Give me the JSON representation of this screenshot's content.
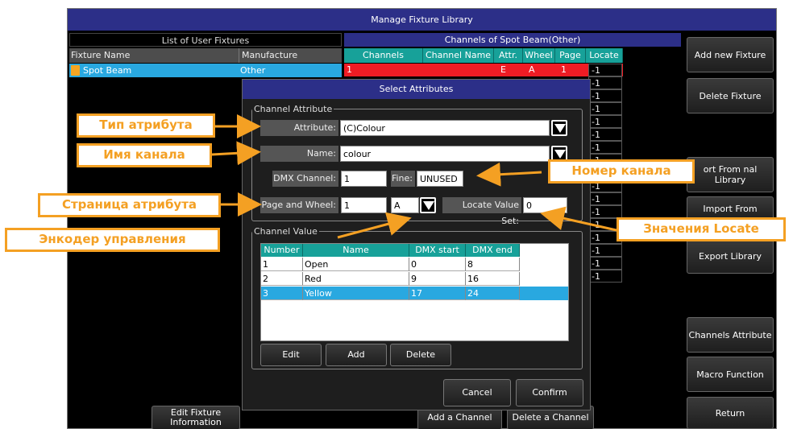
{
  "window": {
    "title": "Manage Fixture Library"
  },
  "left_panel": {
    "title": "List of User Fixtures",
    "columns": [
      "Fixture Name",
      "Manufacture"
    ],
    "rows": [
      {
        "name": "Spot Beam",
        "manufacturer": "Other"
      }
    ]
  },
  "channel_panel": {
    "title": "Channels of Spot Beam(Other)",
    "columns": [
      "Channels",
      "Channel Name",
      "Attr.",
      "Wheel",
      "Page",
      "Locate"
    ],
    "first_row": {
      "channel": "1",
      "attr": "E",
      "wheel": "A",
      "page": "1",
      "locate": "-1"
    },
    "locate_values": [
      "-1",
      "-1",
      "-1",
      "-1",
      "-1",
      "-1",
      "-1",
      "-1",
      "-1",
      "-1",
      "-1",
      "-1",
      "-1",
      "-1",
      "-1",
      "-1",
      "-1"
    ]
  },
  "right_buttons": {
    "add_new": "Add new Fixture",
    "delete": "Delete Fixture",
    "import_internal": "ort From nal Library",
    "import_from": "Import From",
    "export": "Export Library",
    "channels_attr": "Channels Attribute",
    "macro": "Macro Function",
    "return": "Return"
  },
  "bottom_buttons": {
    "edit_info": "Edit Fixture Information",
    "add_channel": "Add a Channel",
    "delete_channel": "Delete a Channel"
  },
  "dialog": {
    "title": "Select Attributes",
    "channel_attribute_legend": "Channel Attribute",
    "attribute_label": "Attribute:",
    "attribute_value": "(C)Colour",
    "name_label": "Name:",
    "name_value": "colour",
    "dmx_label": "DMX Channel:",
    "dmx_value": "1",
    "fine_label": "Fine:",
    "fine_value": "UNUSED",
    "page_wheel_label": "Page and Wheel:",
    "page_value": "1",
    "wheel_value": "A",
    "locate_label": "Locate Value Set:",
    "locate_value": "0",
    "channel_value_legend": "Channel Value",
    "value_columns": [
      "Number",
      "Name",
      "DMX start",
      "DMX end"
    ],
    "value_rows": [
      {
        "number": "1",
        "name": "Open",
        "start": "0",
        "end": "8"
      },
      {
        "number": "2",
        "name": "Red",
        "start": "9",
        "end": "16"
      },
      {
        "number": "3",
        "name": "Yellow",
        "start": "17",
        "end": "24"
      }
    ],
    "edit": "Edit",
    "add": "Add",
    "delete": "Delete",
    "cancel": "Cancel",
    "confirm": "Confirm"
  },
  "callouts": {
    "attr_type": "Тип атрибута",
    "channel_name": "Имя канала",
    "channel_number": "Номер канала",
    "attr_page": "Страница атрибута",
    "encoder": "Энкодер управления",
    "locate_values": "Значения Locate"
  },
  "colors": {
    "accent": "#2c2f88",
    "teal": "#17a199",
    "selected": "#29a8e0",
    "callout": "#f4a023",
    "red": "#ee1c24"
  }
}
